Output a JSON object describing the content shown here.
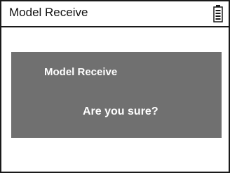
{
  "header": {
    "title": "Model Receive",
    "battery_icon": "battery-icon"
  },
  "dialog": {
    "title": "Model Receive",
    "message": "Are you sure?"
  },
  "colors": {
    "background": "#ffffff",
    "border": "#1a1a1a",
    "dialog_background": "#707070",
    "dialog_text": "#ffffff"
  }
}
